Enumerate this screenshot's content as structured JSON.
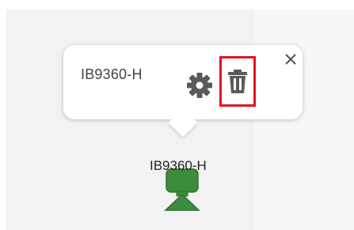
{
  "popup": {
    "title": "IB9360-H",
    "close_icon": "close-icon",
    "settings_icon": "gear-icon",
    "delete_icon": "trash-icon",
    "highlight_color": "#e8101e"
  },
  "device": {
    "label": "IB9360-H",
    "icon": "camera-device-icon",
    "color": "#3d8b3d"
  }
}
